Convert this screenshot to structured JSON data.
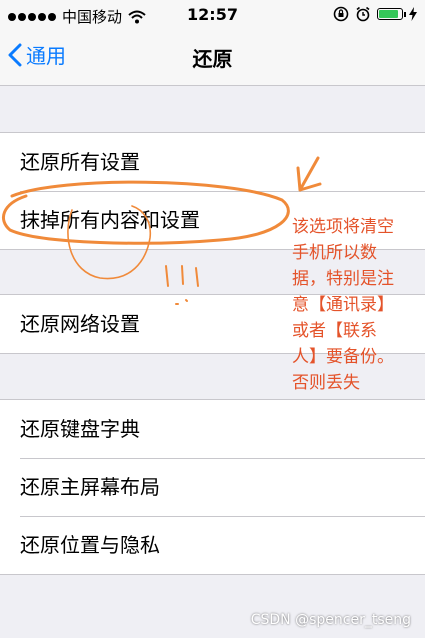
{
  "status_bar": {
    "carrier": "中国移动",
    "time": "12:57",
    "battery_color": "#35c759"
  },
  "nav": {
    "back_label": "通用",
    "title": "还原"
  },
  "groups": [
    {
      "items": [
        {
          "label": "还原所有设置"
        },
        {
          "label": "抹掉所有内容和设置"
        }
      ]
    },
    {
      "items": [
        {
          "label": "还原网络设置"
        }
      ]
    },
    {
      "items": [
        {
          "label": "还原键盘字典"
        },
        {
          "label": "还原主屏幕布局"
        },
        {
          "label": "还原位置与隐私"
        }
      ]
    }
  ],
  "annotation": {
    "lines": [
      "该选项将清空",
      "手机所以数",
      "据，特别是注",
      "意【通讯录】",
      "或者【联系",
      "人】要备份。",
      "否则丢失"
    ],
    "color": "#e4532a"
  },
  "watermark": "CSDN @spencer_tseng",
  "colors": {
    "ios_blue": "#0a7bff",
    "background": "#efeff4",
    "annotation_orange": "#f08a3a"
  }
}
